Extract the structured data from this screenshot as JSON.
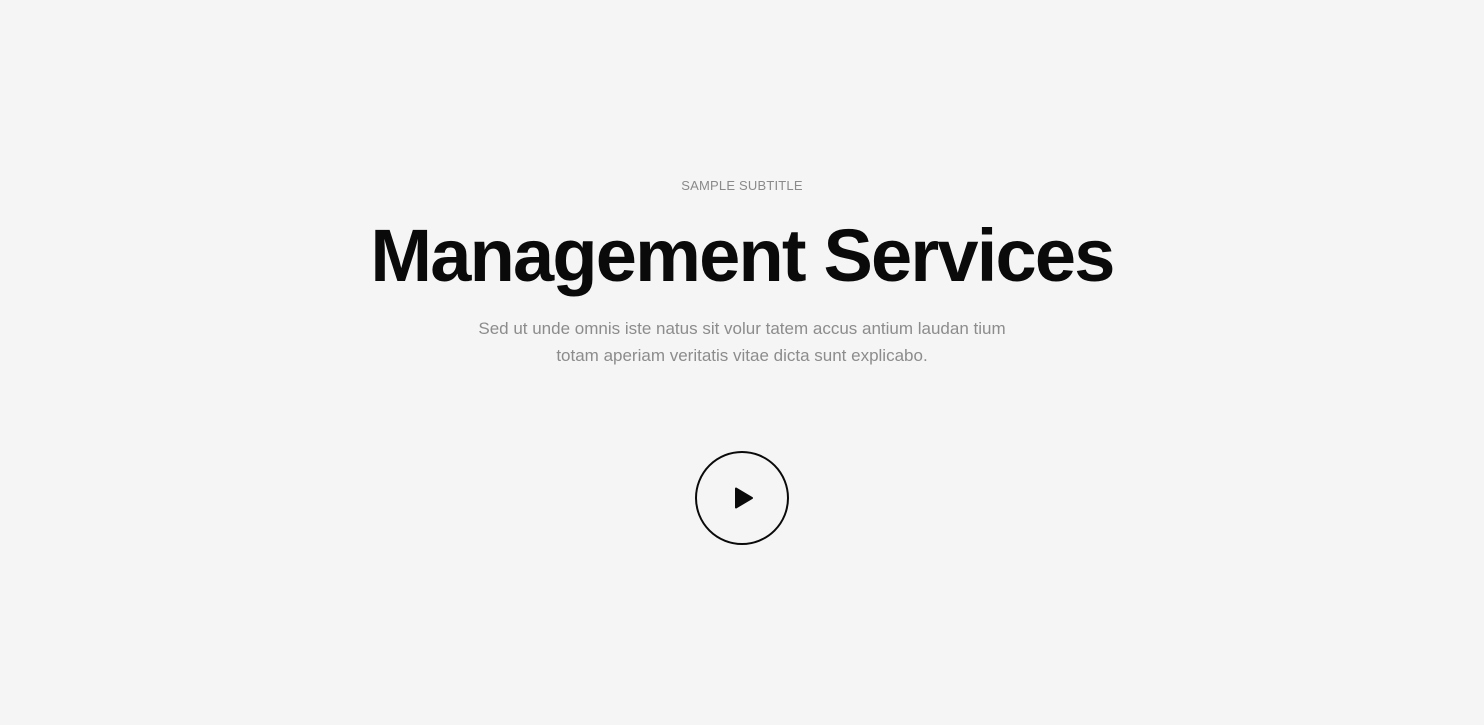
{
  "hero": {
    "subtitle": "SAMPLE SUBTITLE",
    "title": "Management Services",
    "description_line1": "Sed ut unde omnis iste natus sit volur tatem accus antium laudan tium",
    "description_line2": "totam aperiam veritatis vitae dicta sunt explicabo.",
    "play_button": {
      "icon": "play-icon"
    }
  },
  "colors": {
    "background": "#f5f5f5",
    "title": "#0a0a0a",
    "muted_text": "#8c8c8c",
    "button_border": "#0a0a0a"
  }
}
